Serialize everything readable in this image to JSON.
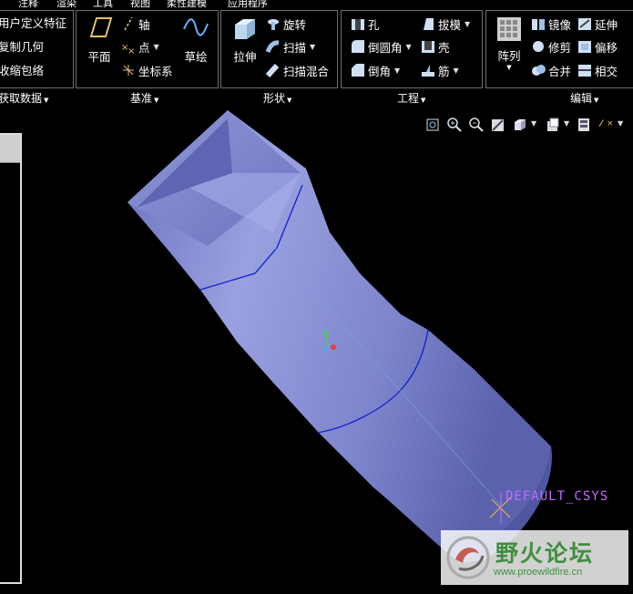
{
  "menubar": {
    "items": [
      "注释",
      "渲染",
      "工具",
      "视图",
      "柔性建模",
      "应用程序"
    ]
  },
  "ribbon": {
    "get_data": {
      "items": [
        "用户定义特征",
        "复制几何",
        "收缩包络"
      ],
      "label": "获取数据"
    },
    "datum": {
      "plane": "平面",
      "axis": "轴",
      "point": "点",
      "csys": "坐标系",
      "sketch": "草绘",
      "label": "基准"
    },
    "shapes": {
      "extrude": "拉伸",
      "revolve": "旋转",
      "sweep": "扫描",
      "swept_blend": "扫描混合",
      "label": "形状"
    },
    "engineering": {
      "hole": "孔",
      "draft": "拔模",
      "round": "倒圆角",
      "shell": "壳",
      "chamfer": "倒角",
      "rib": "筋",
      "label": "工程"
    },
    "editing": {
      "pattern": "阵列",
      "mirror": "镜像",
      "extend": "延伸",
      "trim": "修剪",
      "offset": "偏移",
      "merge": "合并",
      "intersect": "相交",
      "label": "编辑"
    }
  },
  "viewport": {
    "csys_label": "DEFAULT_CSYS",
    "watermark_title": "野火论坛",
    "watermark_url": "www.proewildfire.cn"
  },
  "colors": {
    "model": "#8088cc",
    "edge": "#1020d0",
    "accent": "#3e8f3e"
  }
}
